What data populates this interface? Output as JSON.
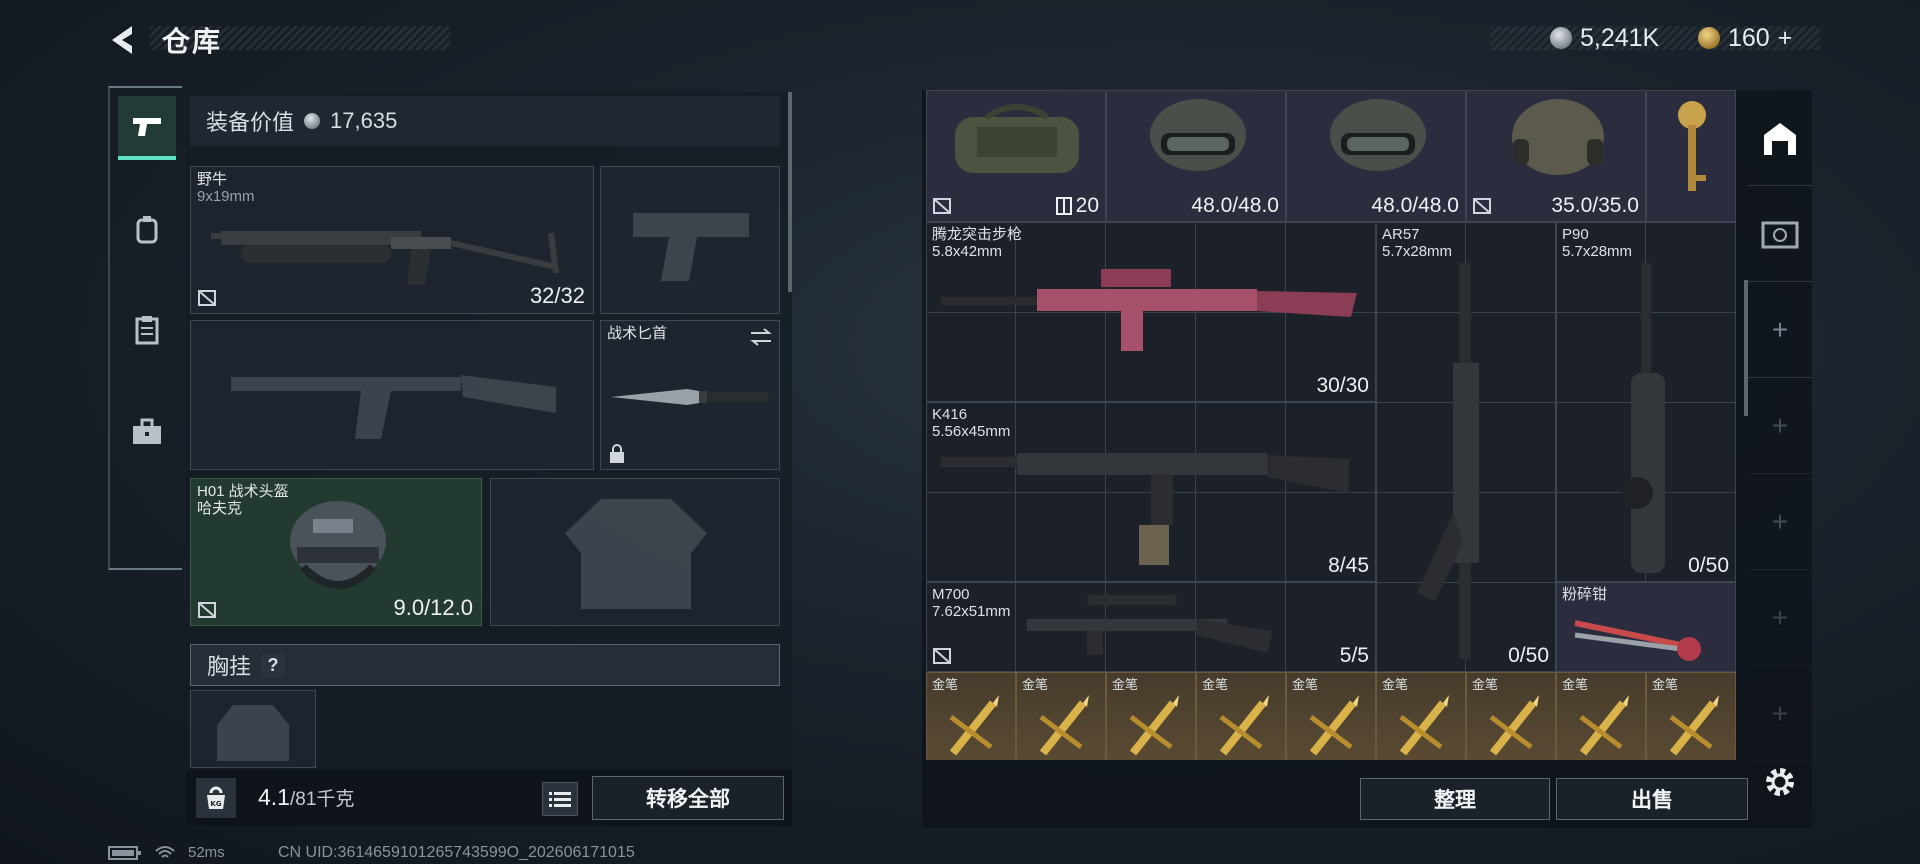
{
  "header": {
    "title": "仓库",
    "silver_amount": "5,241K",
    "gold_amount": "160",
    "gold_plus": "+"
  },
  "left": {
    "value_label": "装备价值",
    "value_amount": "17,635",
    "slots": {
      "primary": {
        "name": "野牛",
        "caliber": "9x19mm",
        "ammo": "32/32"
      },
      "knife": {
        "name": "战术匕首"
      },
      "helmet": {
        "name": "H01 战术头盔",
        "sub": "哈夫克",
        "durability": "9.0/12.0"
      }
    },
    "chest_rig_label": "胸挂",
    "chest_rig_help": "?",
    "weight_value": "4.1",
    "weight_max": "/81千克",
    "kg_badge": "KG",
    "transfer_all": "转移全部"
  },
  "grid": {
    "top_row": [
      {
        "qty": "20"
      },
      {
        "qty": "48.0/48.0"
      },
      {
        "qty": "48.0/48.0"
      },
      {
        "qty": "35.0/35.0"
      }
    ],
    "weapons": [
      {
        "name": "腾龙突击步枪",
        "caliber": "5.8x42mm",
        "ammo": "30/30"
      },
      {
        "name": "AR57",
        "caliber": "5.7x28mm",
        "ammo": "0/50"
      },
      {
        "name": "P90",
        "caliber": "5.7x28mm",
        "ammo": "0/50"
      },
      {
        "name": "K416",
        "caliber": "5.56x45mm",
        "ammo": "8/45"
      },
      {
        "name": "M700",
        "caliber": "7.62x51mm",
        "ammo": "5/5"
      },
      {
        "name": "粉碎钳"
      }
    ],
    "gold_pens": [
      "金笔",
      "金笔",
      "金笔",
      "金笔",
      "金笔",
      "金笔",
      "金笔",
      "金笔",
      "金笔"
    ]
  },
  "buttons": {
    "sort": "整理",
    "sell": "出售"
  },
  "status": {
    "ping": "52ms",
    "uid": "CN UID:3614659101265743599O_202606171015"
  },
  "colors": {
    "accent": "#5ce0c0",
    "gold_cell": "#5a4a32",
    "purple_cell": "#2b2c3e"
  }
}
